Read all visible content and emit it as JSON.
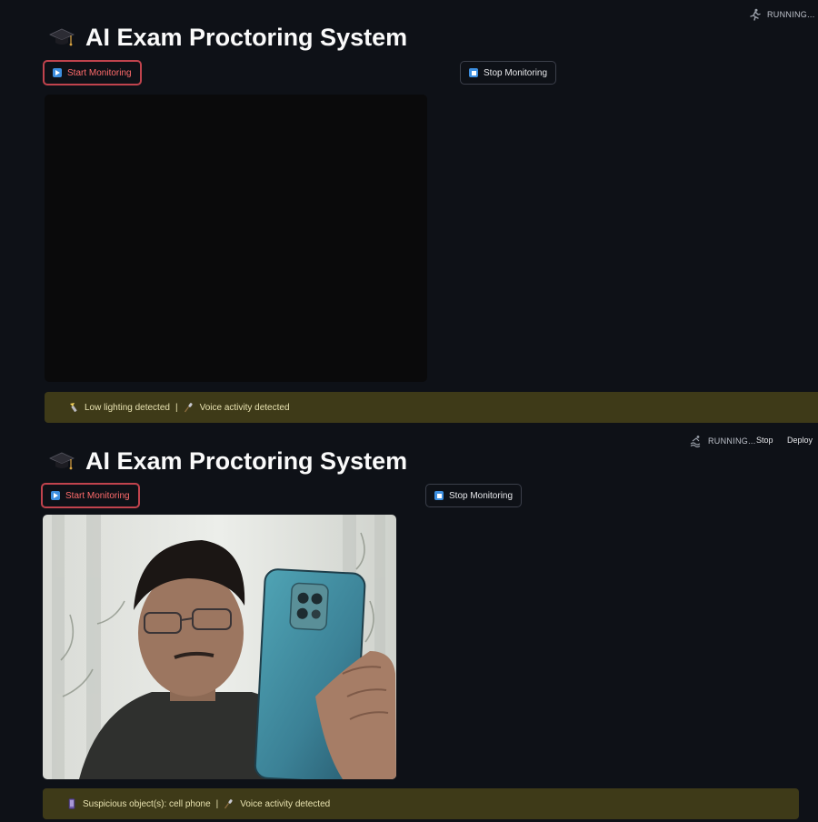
{
  "top_panel": {
    "status": "RUNNING...",
    "title": "AI Exam Proctoring System",
    "start_button": "Start Monitoring",
    "stop_button": "Stop Monitoring",
    "alert": {
      "item1": "Low lighting detected",
      "separator": "|",
      "item2": "Voice activity detected"
    }
  },
  "bottom_panel": {
    "status": "RUNNING...",
    "header_stop": "Stop",
    "header_deploy": "Deploy",
    "title": "AI Exam Proctoring System",
    "start_button": "Start Monitoring",
    "stop_button": "Stop Monitoring",
    "alert": {
      "item1": "Suspicious object(s): cell phone",
      "separator": "|",
      "item2": "Voice activity detected"
    }
  },
  "colors": {
    "background": "#0e1117",
    "start_border": "#c0434d",
    "start_text": "#ff6b6b",
    "alert_bg": "#3e3a18",
    "icon_blue": "#3d8fe0"
  },
  "icons": {
    "title": "graduation-cap-icon",
    "start": "play-button-icon",
    "stop": "stop-button-icon",
    "running": "running-person-icon",
    "lighting": "flashlight-icon",
    "voice": "microphone-icon",
    "suspicious": "phone-icon"
  }
}
